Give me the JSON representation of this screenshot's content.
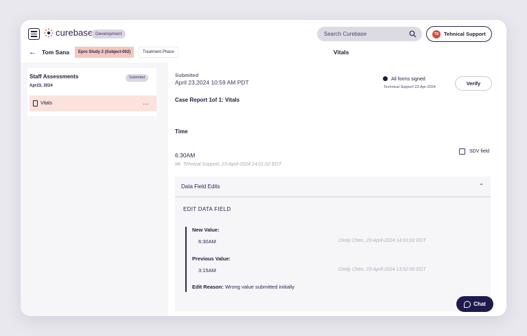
{
  "app": {
    "logo_text": "curebase",
    "environment": "Development",
    "search_placeholder": "Search Curebase",
    "support_initials": "TS",
    "support_label": "Tehnical Support"
  },
  "subheader": {
    "patient_name": "Tom Sana",
    "study": "Epro Study 2 (Subject-002)",
    "phase": "Treatment Phase",
    "page_title": "Vitals"
  },
  "sidebar": {
    "section_title": "Staff Assessments",
    "section_date": "Apr23, 2024",
    "section_status": "Submited",
    "items": [
      {
        "label": "Vitals",
        "more": "…"
      }
    ]
  },
  "main": {
    "submitted_label": "Submited",
    "submitted_date": "April 23,2024 10:59 AM PDT",
    "signed_label": "All forms signed",
    "signed_by": "Technical Support 23-Apr-2024",
    "verify_label": "Verify",
    "case_title": "Case Report 1of 1: Vitals",
    "time_heading": "Time",
    "time_value": "6:30AM",
    "time_meta": "Mr. Tehnical Support, 23-April-2024 14:01:02 EDT",
    "sdv_label": "SDV field",
    "data_field_edits": {
      "title": "Data Field Edits",
      "edit_title": "EDIT DATA FIELD",
      "new_value_label": "New Value:",
      "new_value": "6:30AM",
      "new_value_meta": "Cindy Chen, 23-April-2024 14:01:02 EDT",
      "previous_value_label": "Previous Value:",
      "previous_value": "3:15AM",
      "previous_value_meta": "Cindy Chen, 23-April-2024 13:52:00 EDT",
      "reason_label": "Edit Reason:",
      "reason_value": "Wrong value submitted initially"
    }
  },
  "chat": {
    "label": "Chat"
  },
  "colors": {
    "brand_navy": "#1f1a4d",
    "accent_peach": "#f3c7be",
    "highlight_row": "#fbe2dd",
    "avatar_red": "#d9493c"
  }
}
